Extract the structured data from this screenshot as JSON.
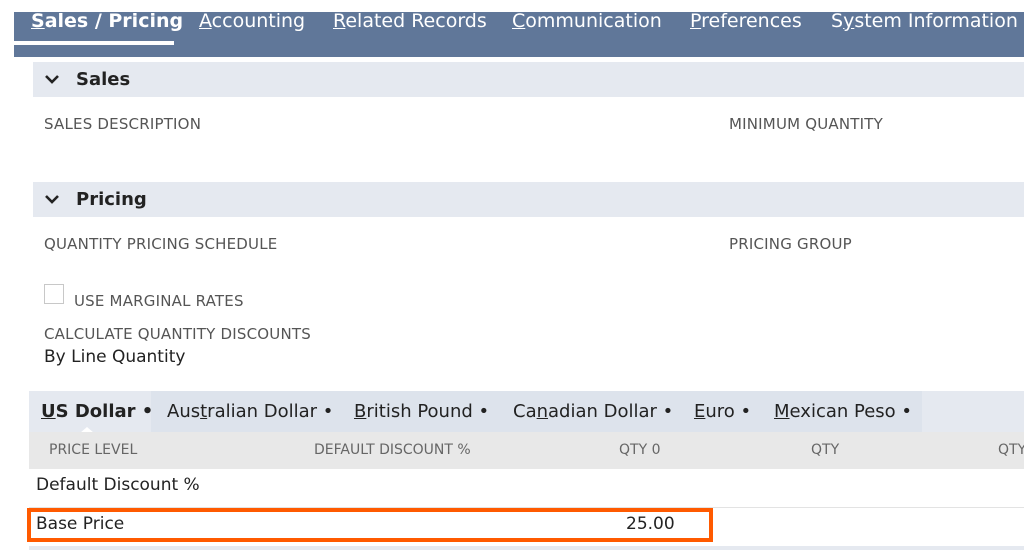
{
  "top_tabs": [
    {
      "pre": "",
      "key": "S",
      "post": "ales / Pricing"
    },
    {
      "pre": "",
      "key": "A",
      "post": "ccounting"
    },
    {
      "pre": "",
      "key": "R",
      "post": "elated Records"
    },
    {
      "pre": "",
      "key": "C",
      "post": "ommunication"
    },
    {
      "pre": "",
      "key": "P",
      "post": "references"
    },
    {
      "pre": "S",
      "key": "y",
      "post": "stem Information"
    }
  ],
  "sections": {
    "sales": {
      "title": "Sales",
      "sales_description_label": "SALES DESCRIPTION",
      "minimum_quantity_label": "MINIMUM QUANTITY"
    },
    "pricing": {
      "title": "Pricing",
      "quantity_pricing_schedule_label": "QUANTITY PRICING SCHEDULE",
      "pricing_group_label": "PRICING GROUP",
      "use_marginal_rates_label": "USE MARGINAL RATES",
      "use_marginal_rates_checked": false,
      "calc_discounts_label": "CALCULATE QUANTITY DISCOUNTS",
      "calc_discounts_value": "By Line Quantity"
    }
  },
  "currency_tabs": [
    {
      "pre": "",
      "key": "U",
      "post": "S Dollar •"
    },
    {
      "pre": "Aus",
      "key": "t",
      "post": "ralian Dollar •"
    },
    {
      "pre": "",
      "key": "B",
      "post": "ritish Pound •"
    },
    {
      "pre": "Ca",
      "key": "n",
      "post": "adian Dollar •"
    },
    {
      "pre": "",
      "key": "E",
      "post": "uro •"
    },
    {
      "pre": "",
      "key": "M",
      "post": "exican Peso •"
    }
  ],
  "price_table": {
    "columns": [
      "PRICE LEVEL",
      "DEFAULT DISCOUNT %",
      "QTY 0",
      "QTY",
      "QTY"
    ],
    "rows": [
      {
        "price_level": "Default Discount %",
        "qty0": ""
      },
      {
        "price_level": "Base Price",
        "qty0": "25.00"
      }
    ]
  },
  "colors": {
    "tab_bar": "#607799",
    "section_header": "#e5e9f0",
    "highlight": "#ff5a00"
  },
  "icons": {
    "section_toggle": "chevron-down-icon"
  }
}
